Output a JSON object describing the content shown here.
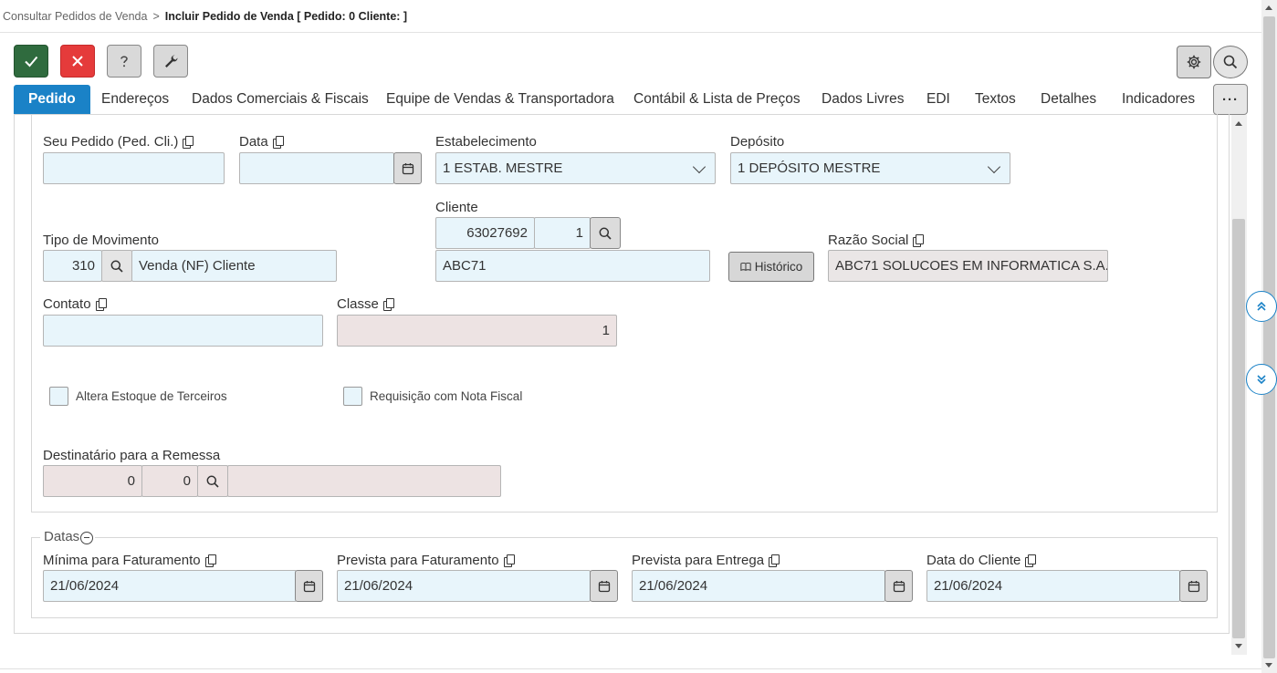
{
  "breadcrumb": {
    "parent": "Consultar Pedidos de Venda",
    "separator": ">",
    "current": "Incluir Pedido de Venda [ Pedido: 0 Cliente: ]"
  },
  "tabs": [
    {
      "label": "Pedido"
    },
    {
      "label": "Endereços"
    },
    {
      "label": "Dados Comerciais & Fiscais"
    },
    {
      "label": "Equipe de Vendas & Transportadora"
    },
    {
      "label": "Contábil & Lista de Preços"
    },
    {
      "label": "Dados Livres"
    },
    {
      "label": "EDI"
    },
    {
      "label": "Textos"
    },
    {
      "label": "Detalhes"
    },
    {
      "label": "Indicadores"
    }
  ],
  "more_label": "···",
  "form": {
    "seu_pedido": {
      "label": "Seu Pedido (Ped. Cli.)",
      "value": ""
    },
    "data": {
      "label": "Data",
      "value": ""
    },
    "estabelecimento": {
      "label": "Estabelecimento",
      "value": "1 ESTAB. MESTRE"
    },
    "deposito": {
      "label": "Depósito",
      "value": "1 DEPÓSITO MESTRE"
    },
    "cliente": {
      "label": "Cliente",
      "code": "63027692",
      "seq": "1",
      "name": "ABC71"
    },
    "tipo_movimento": {
      "label": "Tipo de Movimento",
      "code": "310",
      "description": "Venda (NF) Cliente"
    },
    "historico_label": "Histórico",
    "razao_social": {
      "label": "Razão Social",
      "value": "ABC71 SOLUCOES EM INFORMATICA S.A."
    },
    "contato": {
      "label": "Contato",
      "value": ""
    },
    "classe": {
      "label": "Classe",
      "value": "1"
    },
    "altera_estoque": {
      "label": "Altera Estoque de Terceiros",
      "checked": false
    },
    "requisicao_nf": {
      "label": "Requisição com Nota Fiscal",
      "checked": false
    },
    "destinatario": {
      "label": "Destinatário para a Remessa",
      "code1": "0",
      "code2": "0",
      "name": ""
    }
  },
  "datas": {
    "legend": "Datas",
    "minima_faturamento": {
      "label": "Mínima para Faturamento",
      "value": "21/06/2024"
    },
    "prevista_faturamento": {
      "label": "Prevista para Faturamento",
      "value": "21/06/2024"
    },
    "prevista_entrega": {
      "label": "Prevista para Entrega",
      "value": "21/06/2024"
    },
    "data_cliente": {
      "label": "Data do Cliente",
      "value": "21/06/2024"
    }
  }
}
